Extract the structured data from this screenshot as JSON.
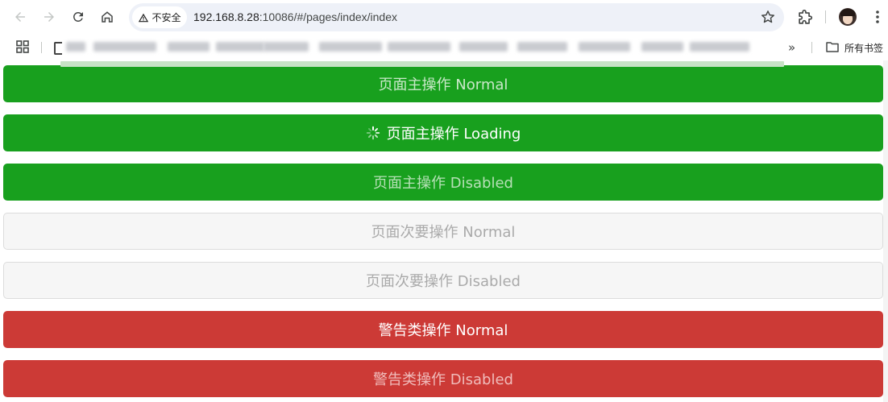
{
  "browser": {
    "security_label": "不安全",
    "url_host": "192.168.8.28",
    "url_path": ":10086/#/pages/index/index",
    "bookmarks_all_label": "所有书签",
    "overflow_label": "»",
    "page_load_progress": 0.95
  },
  "buttons": {
    "primary_normal": "页面主操作 Normal",
    "primary_loading": "页面主操作 Loading",
    "primary_disabled": "页面主操作 Disabled",
    "secondary_normal": "页面次要操作 Normal",
    "secondary_disabled": "页面次要操作 Disabled",
    "warn_normal": "警告类操作 Normal",
    "warn_disabled": "警告类操作 Disabled"
  },
  "colors": {
    "primary": "#18a01e",
    "warn": "#cc3a36",
    "secondary_bg": "#f6f6f6"
  },
  "icons": [
    "back-icon",
    "forward-icon",
    "reload-icon",
    "home-icon",
    "warning-icon",
    "star-icon",
    "extensions-icon",
    "menu-icon",
    "apps-icon",
    "folder-icon",
    "spinner-icon"
  ]
}
